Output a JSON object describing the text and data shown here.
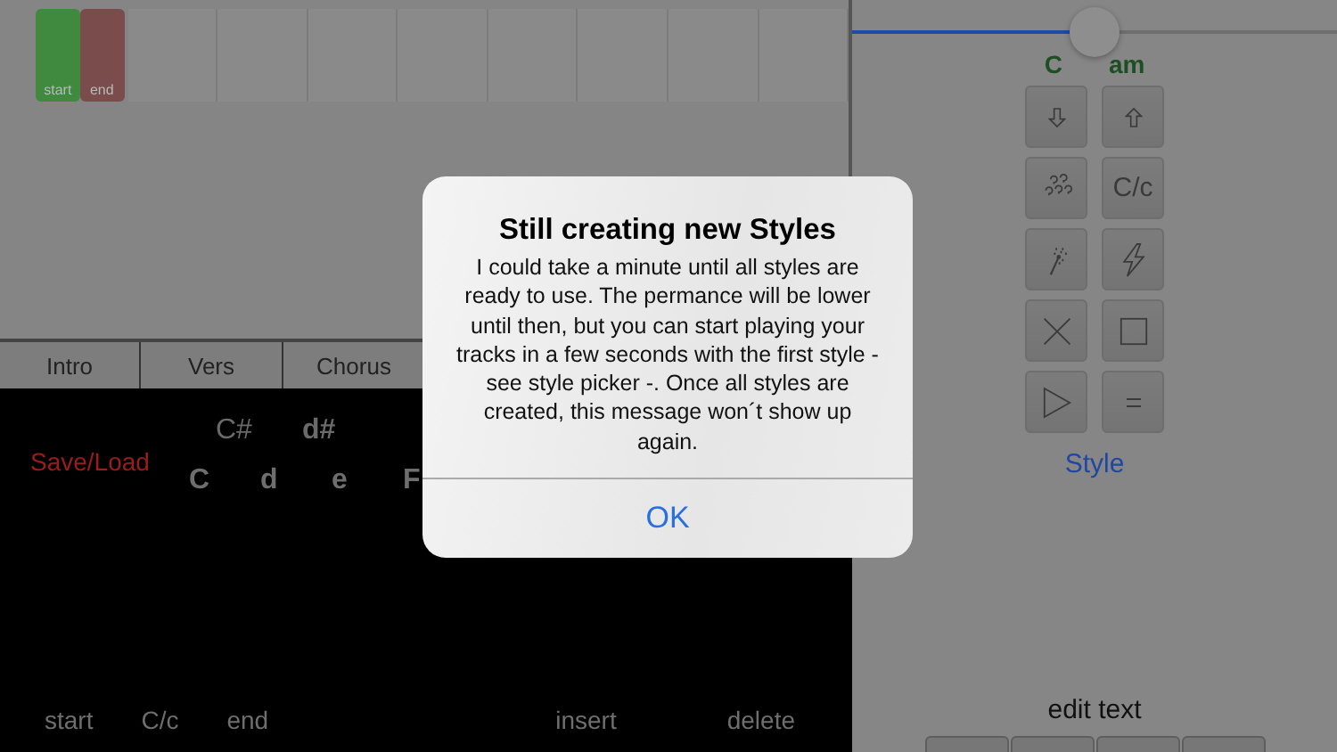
{
  "timeline": {
    "markers": [
      {
        "label": "start",
        "color": "#3f8a3f"
      },
      {
        "label": "end",
        "color": "#7a4c4c"
      }
    ]
  },
  "sections": [
    {
      "label": "Intro"
    },
    {
      "label": "Vers"
    },
    {
      "label": "Chorus"
    }
  ],
  "editor": {
    "save_load": "Save/Load",
    "sharp_keys": [
      "C#",
      "d#"
    ],
    "natural_keys": [
      "C",
      "d",
      "e",
      "F"
    ],
    "bottom_actions": [
      "start",
      "C/c",
      "end",
      "insert",
      "delete"
    ]
  },
  "style_panel": {
    "slider": {
      "level": 0.5
    },
    "key_labels": [
      "C",
      "am"
    ],
    "buttons": [
      {
        "kind": "down"
      },
      {
        "kind": "up"
      },
      {
        "kind": "random"
      },
      {
        "kind": "text",
        "label": "C/c"
      },
      {
        "kind": "wand"
      },
      {
        "kind": "bolt"
      },
      {
        "kind": "cross"
      },
      {
        "kind": "stop"
      },
      {
        "kind": "play"
      },
      {
        "kind": "equal"
      }
    ],
    "style_link": "Style",
    "edit_text": "edit text"
  },
  "dialog": {
    "title": "Still creating new Styles",
    "message": "I could take a minute until all styles are ready to use. The permance will be lower until then, but you can start playing your tracks in a few seconds with the first style - see style picker -. Once all styles are created, this message won´t show up again.",
    "button": "OK"
  }
}
